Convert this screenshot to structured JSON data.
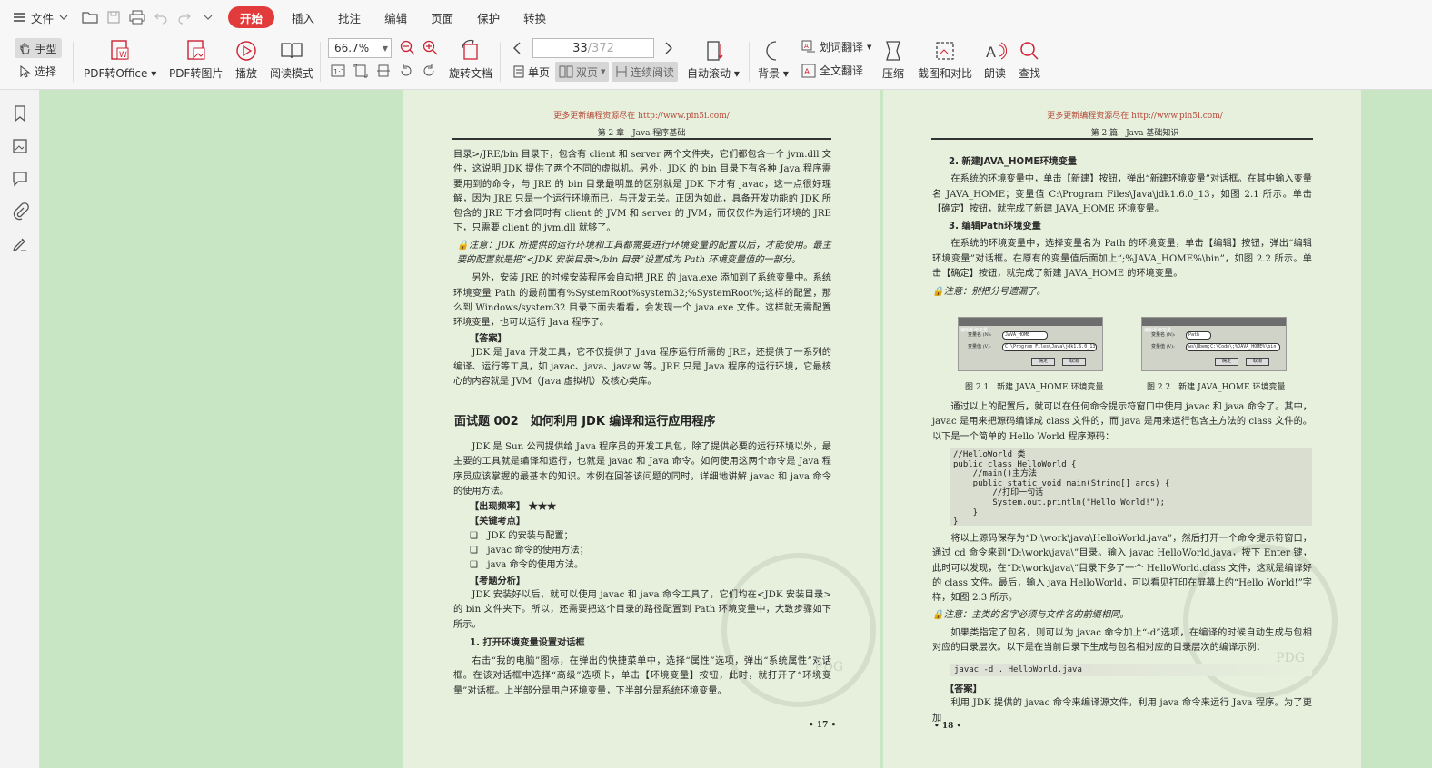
{
  "menu": {
    "file_label": "文件",
    "tabs": [
      "开始",
      "插入",
      "批注",
      "编辑",
      "页面",
      "保护",
      "转换"
    ]
  },
  "ribbon": {
    "hand_label": "手型",
    "select_label": "选择",
    "pdf_to_office": "PDF转Office",
    "pdf_to_image": "PDF转图片",
    "play": "播放",
    "read_mode": "阅读模式",
    "zoom_value": "66.7%",
    "rotate_doc": "旋转文档",
    "page_current": "33",
    "page_total": "/372",
    "single_page": "单页",
    "double_page": "双页",
    "continuous": "连续阅读",
    "auto_scroll": "自动滚动",
    "background": "背景",
    "word_translate": "划词翻译",
    "full_translate": "全文翻译",
    "compress": "压缩",
    "screenshot_compare": "截图和对比",
    "read_aloud": "朗读",
    "find": "查找"
  },
  "left_page": {
    "header_url": "更多更新编程资源尽在 http://www.pin5i.com/",
    "header_chapter": "第 2 章　Java 程序基础",
    "p1": "目录>/JRE/bin 目录下，包含有 client 和 server 两个文件夹，它们都包含一个 jvm.dll 文件，这说明 JDK 提供了两个不同的虚拟机。另外，JDK 的 bin 目录下有各种 Java 程序需要用到的命令，与 JRE 的 bin 目录最明显的区别就是 JDK 下才有 javac，这一点很好理解，因为 JRE 只是一个运行环境而已，与开发无关。正因为如此，具备开发功能的 JDK 所包含的 JRE 下才会同时有 client 的 JVM 和 server 的 JVM，而仅仅作为运行环境的 JRE 下，只需要 client 的 jvm.dll 就够了。",
    "note1": "注意：JDK 所提供的运行环境和工具都需要进行环境变量的配置以后，才能使用。最主要的配置就是把“<JDK 安装目录>/bin 目录”设置成为 Path 环境变量值的一部分。",
    "p2": "另外，安装 JRE 的时候安装程序会自动把 JRE 的 java.exe 添加到了系统变量中。系统环境变量 Path 的最前面有%SystemRoot%system32;%SystemRoot%;这样的配置，那么到 Windows/system32 目录下面去看看，会发现一个 java.exe 文件。这样就无需配置环境变量，也可以运行 Java 程序了。",
    "answer_label": "【答案】",
    "p3": "JDK 是 Java 开发工具，它不仅提供了 Java 程序运行所需的 JRE，还提供了一系列的编译、运行等工具，如 javac、java、javaw 等。JRE 只是 Java 程序的运行环境，它最核心的内容就是 JVM（Java 虚拟机）及核心类库。",
    "title": "面试题 002　如何利用 JDK 编译和运行应用程序",
    "p4": "JDK 是 Sun 公司提供给 Java 程序员的开发工具包，除了提供必要的运行环境以外，最主要的工具就是编译和运行，也就是 javac 和 Java 命令。如何使用这两个命令是 Java 程序员应该掌握的最基本的知识。本例在回答该问题的同时，详细地讲解 javac 和 java 命令的使用方法。",
    "freq_label": "【出现频率】 ★★★",
    "key_label": "【关键考点】",
    "key1": "❑　JDK 的安装与配置；",
    "key2": "❑　javac 命令的使用方法；",
    "key3": "❑　java 命令的使用方法。",
    "analysis_label": "【考题分析】",
    "p5": "JDK 安装好以后，就可以使用 javac 和 java 命令工具了，它们均在<JDK 安装目录>的 bin 文件夹下。所以，还需要把这个目录的路径配置到 Path 环境变量中，大致步骤如下所示。",
    "step1": "1. 打开环境变量设置对话框",
    "p6": "右击“我的电脑”图标，在弹出的快捷菜单中，选择“属性”选项，弹出“系统属性”对话框。在该对话框中选择“高级”选项卡，单击【环境变量】按钮，此时，就打开了“环境变量”对话框。上半部分是用户环境变量，下半部分是系统环境变量。",
    "page_no": "• 17 •"
  },
  "right_page": {
    "header_url": "更多更新编程资源尽在 http://www.pin5i.com/",
    "header_chapter": "第 2 篇　Java 基础知识",
    "step2": "2. 新建JAVA_HOME环境变量",
    "p1": "在系统的环境变量中，单击【新建】按钮，弹出“新建环境变量”对话框。在其中输入变量名 JAVA_HOME；变量值 C:\\Program Files\\Java\\jdk1.6.0_13，如图 2.1 所示。单击【确定】按钮，就完成了新建 JAVA_HOME 环境变量。",
    "step3": "3. 编辑Path环境变量",
    "p2": "在系统的环境变量中，选择变量名为 Path 的环境变量，单击【编辑】按钮，弹出“编辑环境变量”对话框。在原有的变量值后面加上“;%JAVA_HOME%\\bin”，如图 2.2 所示。单击【确定】按钮，就完成了新建 JAVA_HOME 的环境变量。",
    "note1": "注意：别把分号遗漏了。",
    "fig1": {
      "title": "编辑系统变量",
      "name_label": "变量名 (N):",
      "value_label": "变量值 (V):",
      "name_value": "JAVA_HOME",
      "var_value": "C:\\Program Files\\Java\\jdk1.6.0_13",
      "ok": "确定",
      "cancel": "取消",
      "caption": "图 2.1　新建 JAVA_HOME 环境变量"
    },
    "fig2": {
      "title": "编辑系统变量",
      "name_label": "变量名 (N):",
      "value_label": "变量值 (V):",
      "name_value": "Path",
      "var_value": "ws\\Wbem;C:\\Code\\;%JAVA_HOME%\\bin",
      "ok": "确定",
      "cancel": "取消",
      "caption": "图 2.2　新建 JAVA_HOME 环境变量"
    },
    "p3": "通过以上的配置后，就可以在任何命令提示符窗口中使用 javac 和 java 命令了。其中，javac 是用来把源码编译成 class 文件的，而 java 是用来运行包含主方法的 class 文件的。以下是一个简单的 Hello World 程序源码：",
    "code": "//HelloWorld 类\npublic class HelloWorld {\n    //main()主方法\n    public static void main(String[] args) {\n        //打印一句话\n        System.out.println(\"Hello World!\");\n    }\n}",
    "p4": "将以上源码保存为“D:\\work\\java\\HelloWorld.java”，然后打开一个命令提示符窗口，通过 cd 命令来到“D:\\work\\java\\”目录。输入 javac HelloWorld.java，按下 Enter 键，此时可以发现，在“D:\\work\\java\\”目录下多了一个 HelloWorld.class 文件，这就是编译好的 class 文件。最后，输入 java HelloWorld，可以看见打印在屏幕上的“Hello World!”字样，如图 2.3 所示。",
    "note2": "注意：主类的名字必须与文件名的前缀相同。",
    "p5": "如果类指定了包名，则可以为 javac 命令加上“-d”选项，在编译的时候自动生成与包相对应的目录层次。以下是在当前目录下生成与包名相对应的目录层次的编译示例：",
    "code_inline": "javac -d . HelloWorld.java",
    "answer_label": "【答案】",
    "p6": "利用 JDK 提供的 javac 命令来编译源文件，利用 java 命令来运行 Java 程序。为了更加",
    "page_no": "• 18 •"
  }
}
